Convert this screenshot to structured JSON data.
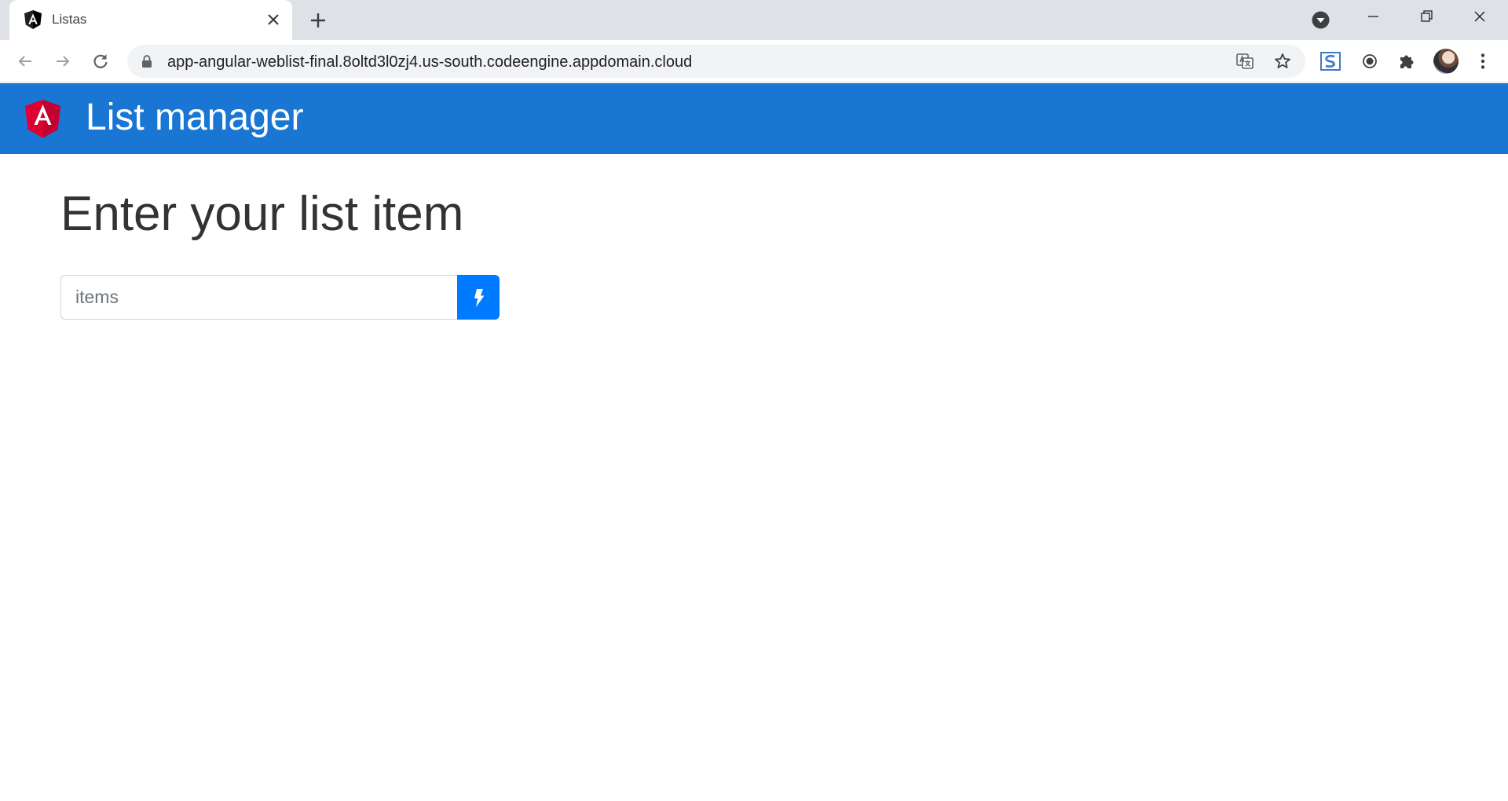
{
  "browser": {
    "tab": {
      "title": "Listas"
    },
    "address_bar": {
      "url": "app-angular-weblist-final.8oltd3l0zj4.us-south.codeengine.appdomain.cloud"
    },
    "toolbar_icons": [
      "back-icon",
      "forward-icon",
      "reload-icon",
      "lock-icon",
      "translate-icon",
      "star-icon",
      "extension-s-icon",
      "record-icon",
      "puzzle-icon",
      "avatar",
      "more-icon"
    ],
    "colors": {
      "tabstrip": "#dee1e6",
      "omnibox": "#f1f3f4"
    }
  },
  "app": {
    "header": {
      "title": "List manager",
      "logo": "angular-logo-icon"
    },
    "main": {
      "heading": "Enter your list item",
      "input": {
        "placeholder": "items",
        "value": ""
      },
      "submit_icon": "bolt-icon"
    },
    "colors": {
      "header": "#1976d2",
      "button": "#007bff",
      "heading": "#333333",
      "logo": "#dd0031"
    }
  }
}
